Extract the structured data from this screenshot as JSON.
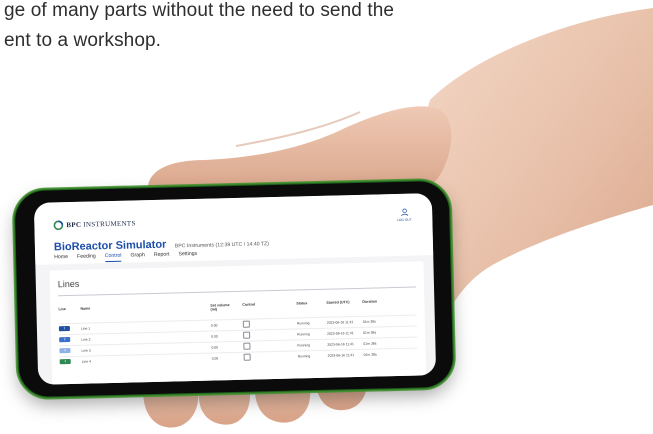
{
  "caption": {
    "line1": "ge of many parts without the need to send the",
    "line2": "ent to a workshop."
  },
  "app": {
    "logo_text_bold": "BPC",
    "logo_text": "INSTRUMENTS",
    "user_label": "LOG OUT",
    "title": "BioReactor Simulator",
    "subtitle": "BPC Instruments (12:39 UTC / 14:40 TZ)",
    "tabs": [
      "Home",
      "Feeding",
      "Control",
      "Graph",
      "Report",
      "Settings"
    ],
    "active_tab": "Control"
  },
  "lines_table": {
    "title": "Lines",
    "columns": [
      "Line",
      "Name",
      "Set volume (ml)",
      "Control",
      "Status",
      "Started (UTC)",
      "Duration"
    ],
    "rows": [
      {
        "line": "1",
        "name": "Line 1",
        "volume": "0.00",
        "status": "Running",
        "started": "2023-06-16 11:41",
        "duration": "01m 38s",
        "color": "#1f4fa3"
      },
      {
        "line": "2",
        "name": "Line 2",
        "volume": "0.00",
        "status": "Running",
        "started": "2023-06-16 11:41",
        "duration": "01m 38s",
        "color": "#3a6fc7"
      },
      {
        "line": "3",
        "name": "Line 3",
        "volume": "0.00",
        "status": "Running",
        "started": "2023-06-16 11:41",
        "duration": "01m 38s",
        "color": "#8fb0e6"
      },
      {
        "line": "4",
        "name": "Line 4",
        "volume": "0.00",
        "status": "Running",
        "started": "2023-06-16 11:41",
        "duration": "01m 38s",
        "color": "#2e8a52"
      }
    ]
  },
  "icons": {
    "logo": "bpc-logo-icon",
    "user": "user-icon",
    "checkbox": "checkbox-icon"
  },
  "colors": {
    "accent": "#1d4fa8",
    "phone_frame": "#3f8f2d"
  }
}
